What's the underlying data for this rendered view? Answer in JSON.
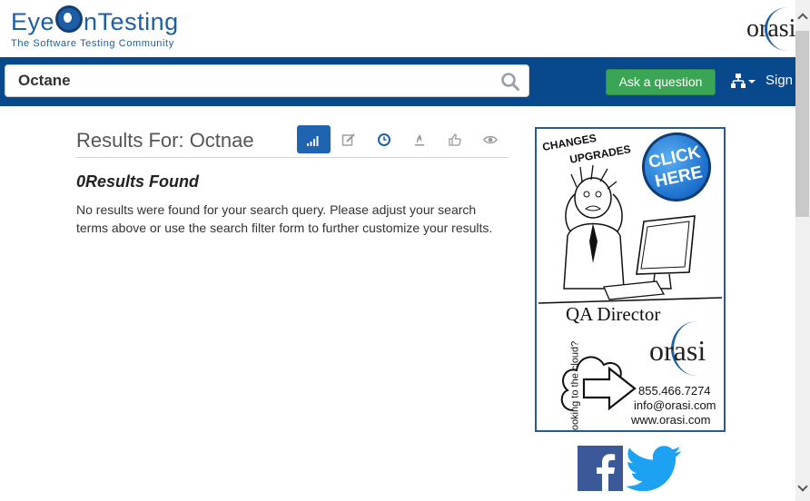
{
  "header": {
    "logo_word": "EyeOnTesting",
    "logo_tagline": "The Software Testing Community",
    "partner_logo": "orasi"
  },
  "nav": {
    "search_value": "Octane",
    "ask_button": "Ask a question",
    "sitemap_icon": "sitemap-icon",
    "signin_label": "Sign"
  },
  "results": {
    "title": "Results For: Octnae",
    "tabs": [
      {
        "name": "relevance",
        "icon": "signal-bars-icon",
        "active": true
      },
      {
        "name": "edited",
        "icon": "edit-icon",
        "active": false
      },
      {
        "name": "recent",
        "icon": "clock-icon",
        "active": false
      },
      {
        "name": "hot",
        "icon": "flame-icon",
        "active": false
      },
      {
        "name": "votes",
        "icon": "thumbs-up-icon",
        "active": false
      },
      {
        "name": "views",
        "icon": "eye-icon",
        "active": false
      }
    ],
    "none_found": "0Results Found",
    "none_text": "No results were found for your search query. Please adjust your search terms above or use the search filter form to further customize your results."
  },
  "ad": {
    "line1": "CHANGES",
    "line2": "UPGRADES",
    "click": "CLICK HERE",
    "role": "QA Director",
    "cloud": "Looking to the cloud?",
    "brand": "orasi",
    "phone": "855.466.7274",
    "email": "info@orasi.com",
    "web": "www.orasi.com"
  },
  "social": [
    "facebook-icon",
    "twitter-icon"
  ],
  "colors": {
    "nav": "#08488c",
    "button": "#3aa655",
    "active_tab": "#1e64b0",
    "brand_blue": "#1c5fa6"
  }
}
